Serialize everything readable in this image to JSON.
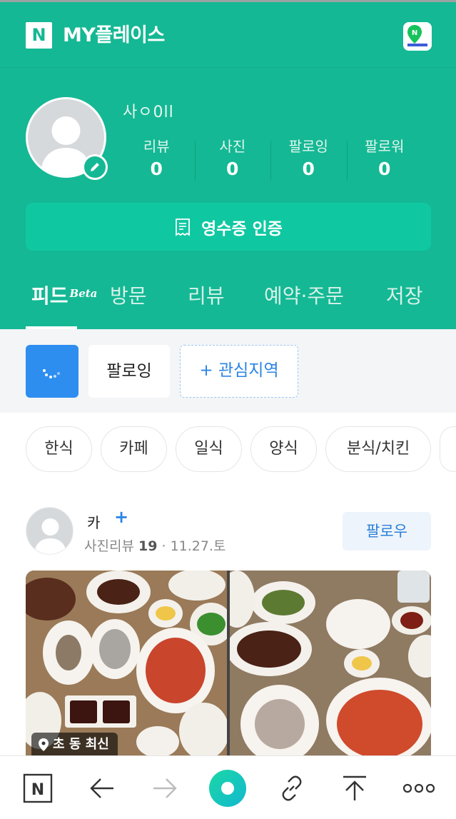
{
  "app_bar": {
    "logo_letter": "N",
    "title": "MY플레이스",
    "map_icon": "naver-map-icon"
  },
  "profile": {
    "nickname": "사ㅇ0ll",
    "stats": [
      {
        "label": "리뷰",
        "value": "0"
      },
      {
        "label": "사진",
        "value": "0"
      },
      {
        "label": "팔로잉",
        "value": "0"
      },
      {
        "label": "팔로워",
        "value": "0"
      }
    ],
    "receipt_button": "영수증 인증"
  },
  "tabs": [
    {
      "label": "피드",
      "badge": "Beta",
      "active": true
    },
    {
      "label": "방문",
      "active": false
    },
    {
      "label": "리뷰",
      "active": false
    },
    {
      "label": "예약·주문",
      "active": false
    },
    {
      "label": "저장",
      "active": false
    }
  ],
  "feed_filters": {
    "following": "팔로잉",
    "interest_area": "+ 관심지역"
  },
  "categories": [
    "한식",
    "카페",
    "일식",
    "양식",
    "분식/치킨"
  ],
  "post": {
    "author": "카",
    "meta_prefix": "사진리뷰",
    "meta_count": "19",
    "meta_separator": "·",
    "date": "11.27.토",
    "follow_button": "팔로우",
    "location_tag": "초 동 최신"
  },
  "bottom_bar": {
    "logo_letter": "N"
  },
  "colors": {
    "brand_green": "#14b894",
    "accent_blue": "#2a84e4"
  }
}
